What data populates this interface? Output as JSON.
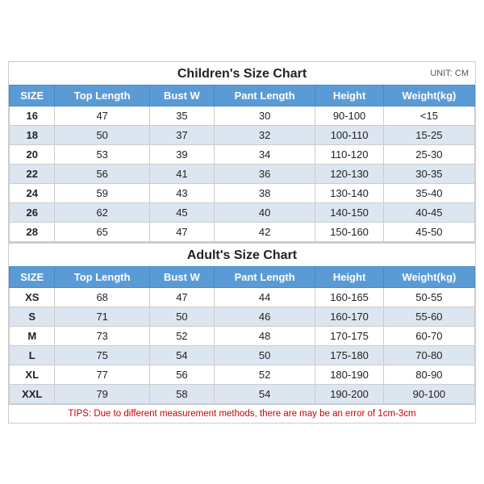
{
  "children_title": "Children's Size Chart",
  "adult_title": "Adult's Size Chart",
  "unit": "UNIT: CM",
  "tips": "TIPS: Due to different measurement methods, there are may be an error of 1cm-3cm",
  "headers": [
    "SIZE",
    "Top Length",
    "Bust W",
    "Pant Length",
    "Height",
    "Weight(kg)"
  ],
  "children_rows": [
    [
      "16",
      "47",
      "35",
      "30",
      "90-100",
      "<15"
    ],
    [
      "18",
      "50",
      "37",
      "32",
      "100-110",
      "15-25"
    ],
    [
      "20",
      "53",
      "39",
      "34",
      "110-120",
      "25-30"
    ],
    [
      "22",
      "56",
      "41",
      "36",
      "120-130",
      "30-35"
    ],
    [
      "24",
      "59",
      "43",
      "38",
      "130-140",
      "35-40"
    ],
    [
      "26",
      "62",
      "45",
      "40",
      "140-150",
      "40-45"
    ],
    [
      "28",
      "65",
      "47",
      "42",
      "150-160",
      "45-50"
    ]
  ],
  "adult_rows": [
    [
      "XS",
      "68",
      "47",
      "44",
      "160-165",
      "50-55"
    ],
    [
      "S",
      "71",
      "50",
      "46",
      "160-170",
      "55-60"
    ],
    [
      "M",
      "73",
      "52",
      "48",
      "170-175",
      "60-70"
    ],
    [
      "L",
      "75",
      "54",
      "50",
      "175-180",
      "70-80"
    ],
    [
      "XL",
      "77",
      "56",
      "52",
      "180-190",
      "80-90"
    ],
    [
      "XXL",
      "79",
      "58",
      "54",
      "190-200",
      "90-100"
    ]
  ]
}
